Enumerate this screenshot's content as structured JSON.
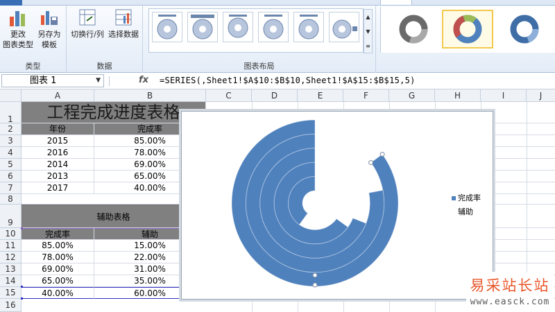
{
  "colors": {
    "series_blue": "#4f81bd",
    "header_gray": "#808080",
    "title_gray": "#808080",
    "selection_purple": "#8b5fbf",
    "selection_blue": "#3030c0",
    "style_selected_border": "#f2c94c",
    "watermark_orange": "#e8572a"
  },
  "ribbon": {
    "type_group": {
      "label": "类型",
      "buttons": [
        {
          "label_line1": "更改",
          "label_line2": "图表类型",
          "icon": "bar-chart-icon"
        },
        {
          "label_line1": "另存为",
          "label_line2": "模板",
          "icon": "save-template-icon"
        }
      ]
    },
    "data_group": {
      "label": "数据",
      "buttons": [
        {
          "label": "切换行/列",
          "icon": "switch-row-column-icon"
        },
        {
          "label": "选择数据",
          "icon": "select-data-icon"
        }
      ]
    },
    "layout_group": {
      "label": "图表布局"
    },
    "style_group": {
      "selected_index": 1
    }
  },
  "formula_bar": {
    "name_box": "图表 1",
    "fx_label": "fx",
    "formula": "=SERIES(,Sheet1!$A$10:$B$10,Sheet1!$A$15:$B$15,5)"
  },
  "columns": [
    "A",
    "B",
    "C",
    "D",
    "E",
    "F",
    "G",
    "H",
    "I",
    "J"
  ],
  "rows": [
    "1",
    "2",
    "3",
    "4",
    "5",
    "6",
    "7",
    "8",
    "9",
    "10",
    "11",
    "12",
    "13",
    "14",
    "15",
    "16"
  ],
  "sheet": {
    "title": "工程完成进度表格",
    "header": {
      "col_a": "年份",
      "col_b": "完成率"
    },
    "data": [
      {
        "year": "2015",
        "rate": "85.00%"
      },
      {
        "year": "2016",
        "rate": "78.00%"
      },
      {
        "year": "2014",
        "rate": "69.00%"
      },
      {
        "year": "2013",
        "rate": "65.00%"
      },
      {
        "year": "2017",
        "rate": "40.00%"
      }
    ],
    "aux_title": "辅助表格",
    "aux_header": {
      "col_a": "完成率",
      "col_b": "辅助"
    },
    "aux_data": [
      {
        "rate": "85.00%",
        "aux": "15.00%"
      },
      {
        "rate": "78.00%",
        "aux": "22.00%"
      },
      {
        "rate": "69.00%",
        "aux": "31.00%"
      },
      {
        "rate": "65.00%",
        "aux": "35.00%"
      },
      {
        "rate": "40.00%",
        "aux": "60.00%"
      }
    ]
  },
  "chart_data": {
    "type": "doughnut",
    "categories": [
      "完成率",
      "辅助"
    ],
    "series": [
      {
        "values": [
          85,
          15
        ]
      },
      {
        "values": [
          78,
          22
        ]
      },
      {
        "values": [
          69,
          31
        ]
      },
      {
        "values": [
          65,
          35
        ]
      },
      {
        "values": [
          40,
          60
        ]
      }
    ],
    "legend": [
      "完成率",
      "辅助"
    ],
    "legend_position": "right",
    "visible_slice": "完成率",
    "hidden_slice": "辅助"
  },
  "watermark": {
    "cn": "易采站长站",
    "url": "www.easck.com"
  }
}
